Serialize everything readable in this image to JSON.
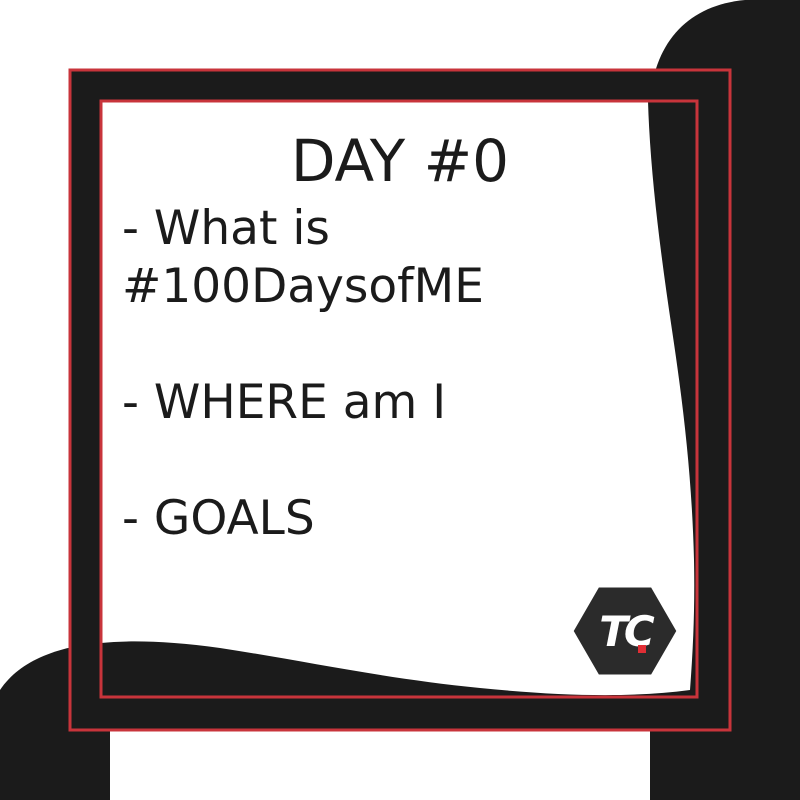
{
  "card": {
    "title": "DAY #0",
    "items": [
      "- What is\n#100DaysofME",
      "- WHERE am I",
      "- GOALS"
    ]
  },
  "logo": {
    "text": "TC",
    "icon": "tc-hexagon-logo"
  },
  "colors": {
    "background_dark": "#1b1b1b",
    "frame_accent": "#c8343b",
    "card_fill": "#ffffff",
    "text": "#1b1b1b",
    "logo_hex": "#2b2b2b",
    "logo_dot": "#e02e35"
  }
}
